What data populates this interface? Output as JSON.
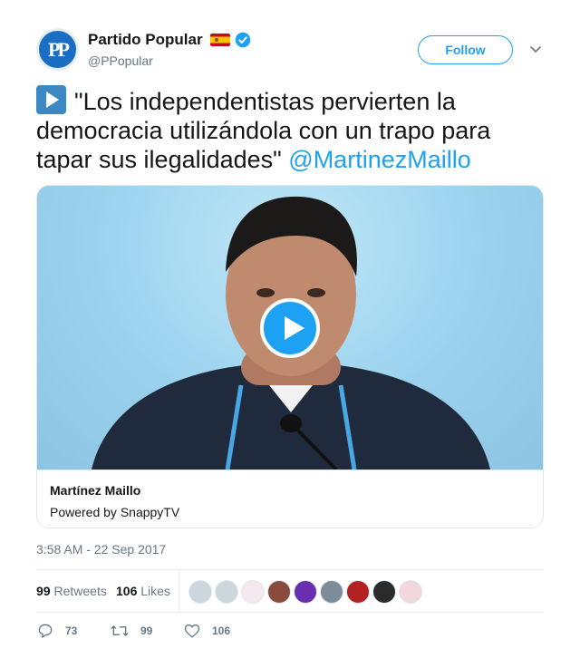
{
  "account": {
    "name": "Partido Popular",
    "handle": "@PPopular",
    "avatar_text": "PP",
    "follow_label": "Follow"
  },
  "tweet": {
    "text": "\"Los independentistas pervierten la democracia utilizándola con un trapo para tapar sus ilegalidades\"",
    "mention": "@MartinezMaillo",
    "timestamp": "3:58 AM - 22 Sep 2017"
  },
  "card": {
    "title": "Martínez Maillo",
    "subtitle": "Powered by SnappyTV"
  },
  "stats": {
    "retweets_count": "99",
    "retweets_label": "Retweets",
    "likes_count": "106",
    "likes_label": "Likes"
  },
  "actions": {
    "reply_count": "73",
    "retweet_count": "99",
    "like_count": "106"
  },
  "colors": {
    "accent": "#1da1f2",
    "text": "#14171a",
    "muted": "#657786"
  },
  "icons": [
    "spain-flag-icon",
    "verified-badge-icon",
    "chevron-down-icon",
    "play-button-emoji-icon",
    "play-icon",
    "reply-icon",
    "retweet-icon",
    "heart-icon"
  ]
}
